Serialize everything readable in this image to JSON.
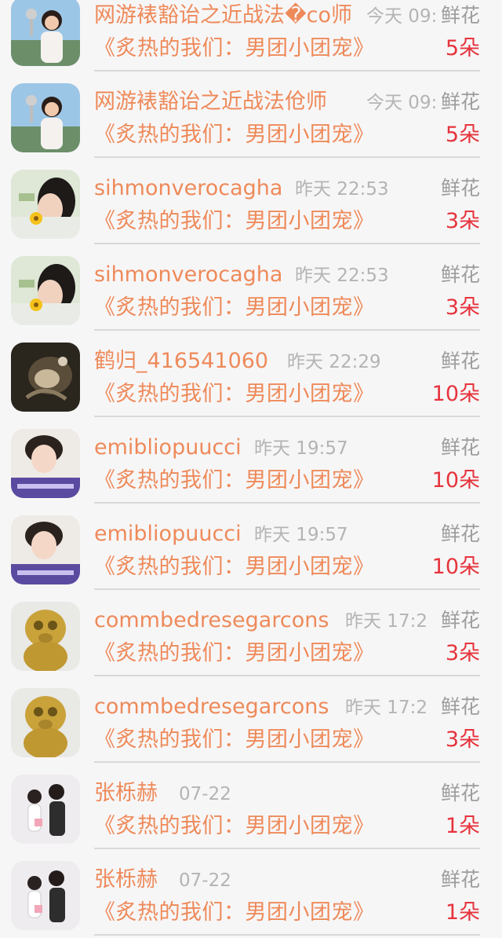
{
  "rows": [
    {
      "name": "网游裱豁诒之近战法�co师",
      "time": "今天 09:",
      "flower_label": "鲜花",
      "book": "《炙热的我们：男团小团宠》",
      "count": "5朵",
      "avatar": "girl-cup"
    },
    {
      "name": "网游裱豁诒之近战法伧师",
      "time": "今天 09:",
      "flower_label": "鲜花",
      "book": "《炙热的我们：男团小团宠》",
      "count": "5朵",
      "avatar": "girl-cup"
    },
    {
      "name": "sihmonverocagha",
      "time": "昨天 22:53",
      "flower_label": "鲜花",
      "book": "《炙热的我们：男团小团宠》",
      "count": "3朵",
      "avatar": "woman-flower"
    },
    {
      "name": "sihmonverocagha",
      "time": "昨天 22:53",
      "flower_label": "鲜花",
      "book": "《炙热的我们：男团小团宠》",
      "count": "3朵",
      "avatar": "woman-flower"
    },
    {
      "name": "鹤归_416541060",
      "time": "昨天 22:29",
      "flower_label": "鲜花",
      "book": "《炙热的我们：男团小团宠》",
      "count": "10朵",
      "avatar": "dark-photo"
    },
    {
      "name": "emibliopuucci",
      "time": "昨天 19:57",
      "flower_label": "鲜花",
      "book": "《炙热的我们：男团小团宠》",
      "count": "10朵",
      "avatar": "boy-portrait"
    },
    {
      "name": "emibliopuucci",
      "time": "昨天 19:57",
      "flower_label": "鲜花",
      "book": "《炙热的我们：男团小团宠》",
      "count": "10朵",
      "avatar": "boy-portrait"
    },
    {
      "name": "commbedresegarcons",
      "time": "昨天 17:2",
      "flower_label": "鲜花",
      "book": "《炙热的我们：男团小团宠》",
      "count": "3朵",
      "avatar": "yellow-figurine"
    },
    {
      "name": "commbedresegarcons",
      "time": "昨天 17:2",
      "flower_label": "鲜花",
      "book": "《炙热的我们：男团小团宠》",
      "count": "3朵",
      "avatar": "yellow-figurine"
    },
    {
      "name": "张栎赫",
      "time": "07-22",
      "flower_label": "鲜花",
      "book": "《炙热的我们：男团小团宠》",
      "count": "1朵",
      "avatar": "couple"
    },
    {
      "name": "张栎赫",
      "time": "07-22",
      "flower_label": "鲜花",
      "book": "《炙热的我们：男团小团宠》",
      "count": "1朵",
      "avatar": "couple"
    }
  ]
}
